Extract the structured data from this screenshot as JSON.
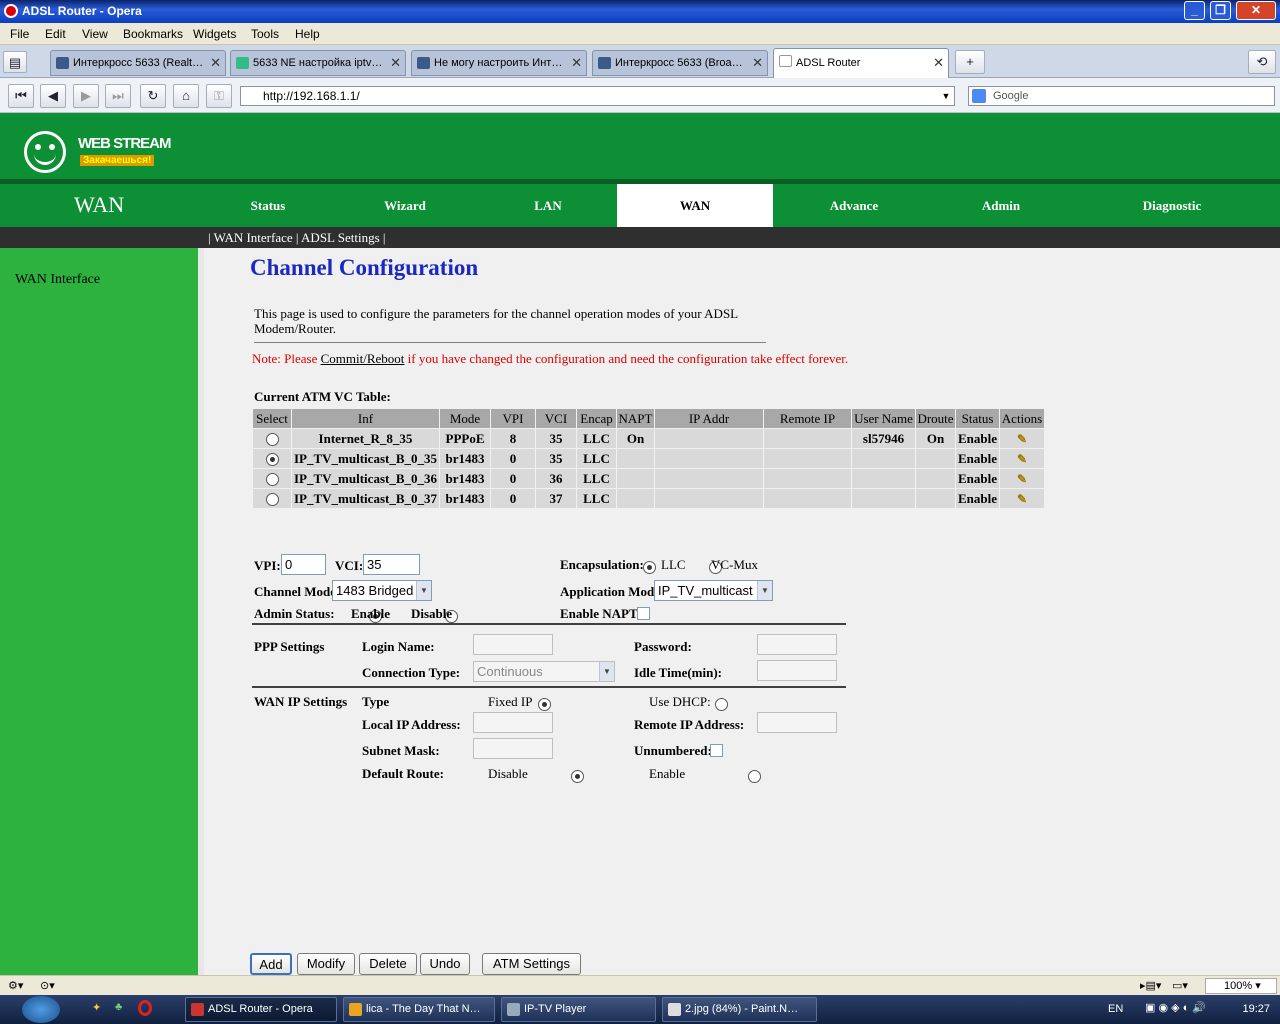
{
  "window": {
    "title": "ADSL Router - Opera"
  },
  "menu": [
    "File",
    "Edit",
    "View",
    "Bookmarks",
    "Widgets",
    "Tools",
    "Help"
  ],
  "tabs": [
    {
      "label": "Интеркросс 5633 (Realt…"
    },
    {
      "label": "5633 NE настройка iptv…"
    },
    {
      "label": "Не могу настроить Инт…"
    },
    {
      "label": "Интеркросс 5633 (Broa…"
    },
    {
      "label": "ADSL Router"
    }
  ],
  "address": {
    "url": "http://192.168.1.1/",
    "search_placeholder": "Google"
  },
  "brand": {
    "name": "WEB STREAM",
    "tagline": "Закачаешься!"
  },
  "nav": {
    "section": "WAN",
    "items": [
      "Status",
      "Wizard",
      "LAN",
      "WAN",
      "Advance",
      "Admin",
      "Diagnostic"
    ],
    "sub": "| WAN Interface | ADSL Settings |"
  },
  "sidebar": {
    "item": "WAN Interface"
  },
  "page": {
    "title": "Channel Configuration",
    "description": "This page is used to configure the parameters for the channel operation modes of your ADSL Modem/Router.",
    "note_pre": "Note: Please ",
    "note_link": "Commit/Reboot",
    "note_post": " if you have changed the configuration and need the configuration take effect forever.",
    "table_label": "Current ATM VC Table:"
  },
  "atm_table": {
    "headers": [
      "Select",
      "Inf",
      "Mode",
      "VPI",
      "VCI",
      "Encap",
      "NAPT",
      "IP Addr",
      "Remote IP",
      "User Name",
      "Droute",
      "Status",
      "Actions"
    ],
    "rows": [
      {
        "selected": false,
        "inf": "Internet_R_8_35",
        "mode": "PPPoE",
        "vpi": "8",
        "vci": "35",
        "encap": "LLC",
        "napt": "On",
        "ip": "",
        "remote": "",
        "user": "sl57946",
        "droute": "On",
        "status": "Enable"
      },
      {
        "selected": true,
        "inf": "IP_TV_multicast_B_0_35",
        "mode": "br1483",
        "vpi": "0",
        "vci": "35",
        "encap": "LLC",
        "napt": "",
        "ip": "",
        "remote": "",
        "user": "",
        "droute": "",
        "status": "Enable"
      },
      {
        "selected": false,
        "inf": "IP_TV_multicast_B_0_36",
        "mode": "br1483",
        "vpi": "0",
        "vci": "36",
        "encap": "LLC",
        "napt": "",
        "ip": "",
        "remote": "",
        "user": "",
        "droute": "",
        "status": "Enable"
      },
      {
        "selected": false,
        "inf": "IP_TV_multicast_B_0_37",
        "mode": "br1483",
        "vpi": "0",
        "vci": "37",
        "encap": "LLC",
        "napt": "",
        "ip": "",
        "remote": "",
        "user": "",
        "droute": "",
        "status": "Enable"
      }
    ]
  },
  "form": {
    "vpi_label": "VPI:",
    "vpi_value": "0",
    "vci_label": "VCI:",
    "vci_value": "35",
    "encap_label": "Encapsulation:",
    "encap_llc": "LLC",
    "encap_vcmux": "VC-Mux",
    "channel_mode_label": "Channel Mode",
    "channel_mode_value": "1483 Bridged",
    "app_mode_label": "Application Mode",
    "app_mode_value": "IP_TV_multicast",
    "admin_status_label": "Admin Status:",
    "admin_enable": "Enable",
    "admin_disable": "Disable",
    "napt_label": "Enable NAPT",
    "ppp_label": "PPP Settings",
    "login_label": "Login Name:",
    "password_label": "Password:",
    "conn_type_label": "Connection Type:",
    "conn_type_value": "Continuous",
    "idle_label": "Idle Time(min):",
    "wanip_label": "WAN IP Settings",
    "type_label": "Type",
    "fixed_ip": "Fixed IP",
    "use_dhcp": "Use DHCP:",
    "local_ip_label": "Local IP Address:",
    "remote_ip_label": "Remote IP Address:",
    "subnet_label": "Subnet Mask:",
    "unnumbered_label": "Unnumbered:",
    "default_route_label": "Default Route:",
    "dr_disable": "Disable",
    "dr_enable": "Enable"
  },
  "buttons": {
    "add": "Add",
    "modify": "Modify",
    "delete": "Delete",
    "undo": "Undo",
    "atm": "ATM Settings"
  },
  "statusbar": {
    "zoom": "100%"
  },
  "taskbar": {
    "tasks": [
      "ADSL Router - Opera",
      "lica - The Day That N…",
      "IP-TV Player",
      "2.jpg (84%) - Paint.N…"
    ],
    "lang": "EN",
    "clock": "19:27"
  },
  "colors": {
    "brand_green": "#0d8f35",
    "sidebar_green": "#2db23f",
    "title_blue": "#1c28c3",
    "note_red": "#dd0000"
  }
}
